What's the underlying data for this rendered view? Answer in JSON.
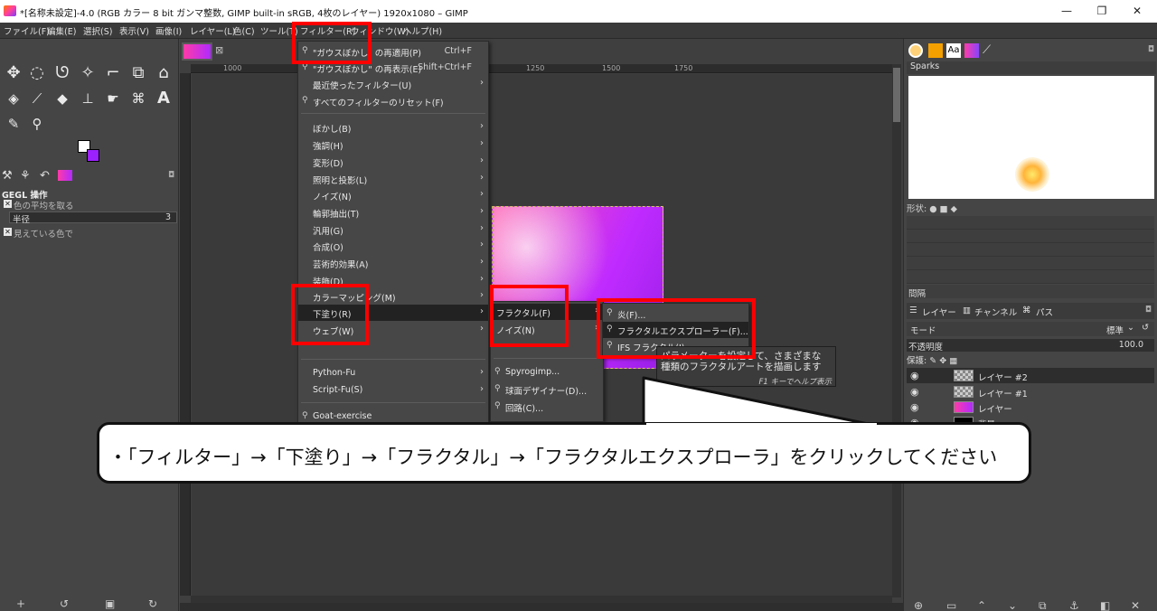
{
  "window": {
    "title": "*[名称未設定]-4.0 (RGB カラー 8 bit ガンマ整数, GIMP built-in sRGB, 4枚のレイヤー) 1920x1080 – GIMP",
    "minimize": "—",
    "maximize": "❐",
    "close": "✕"
  },
  "menubar": [
    "ファイル(F)",
    "編集(E)",
    "選択(S)",
    "表示(V)",
    "画像(I)",
    "レイヤー(L)",
    "色(C)",
    "ツール(T)",
    "フィルター(R)",
    "ウィンドウ(W)",
    "ヘルプ(H)"
  ],
  "tool_options": {
    "title": "GEGL 操作",
    "option1": "色の平均を取る",
    "radius_label": "半径",
    "radius_value": "3",
    "option2": "見えている色で"
  },
  "canvas": {
    "ruler_ticks": [
      "1000",
      "1250",
      "1500",
      "1750"
    ]
  },
  "filters_menu": {
    "items": [
      {
        "label": "\"ガウスぼかし\" の再適用(P)",
        "shortcut": "Ctrl+F"
      },
      {
        "label": "\"ガウスぼかし\" の再表示(E)",
        "shortcut": "Shift+Ctrl+F"
      },
      {
        "label": "最近使ったフィルター(U)"
      },
      {
        "label": "すべてのフィルターのリセット(F)"
      },
      {
        "label": "ぼかし(B)"
      },
      {
        "label": "強調(H)"
      },
      {
        "label": "変形(D)"
      },
      {
        "label": "照明と投影(L)"
      },
      {
        "label": "ノイズ(N)"
      },
      {
        "label": "輪郭抽出(T)"
      },
      {
        "label": "汎用(G)"
      },
      {
        "label": "合成(O)"
      },
      {
        "label": "芸術的効果(A)"
      },
      {
        "label": "装飾(D)"
      },
      {
        "label": "カラーマッピング(M)"
      },
      {
        "label": "下塗り(R)"
      },
      {
        "label": "ウェブ(W)"
      },
      {
        "label": "Python-Fu"
      },
      {
        "label": "Script-Fu(S)"
      },
      {
        "label": "Goat-exercise"
      }
    ]
  },
  "render_menu": {
    "items": [
      "フラクタル(F)",
      "ノイズ(N)",
      "Spyrogimp...",
      "球面デザイナー(D)...",
      "回路(C)..."
    ]
  },
  "fractal_menu": {
    "items": [
      "炎(F)...",
      "フラクタルエクスプローラー(F)...",
      "IFS フラクタル(I)..."
    ]
  },
  "tooltip": {
    "line1": "パラメーターを設定して、さまざまな",
    "line2": "種類のフラクタルアートを描画します",
    "hint": "F1 キーでヘルプ表示"
  },
  "callout": {
    "text": "・「フィルター」→「下塗り」→「フラクタル」→「フラクタルエクスプローラ」をクリックしてください"
  },
  "dock": {
    "brush_name": "Sparks",
    "shape_label": "形状:",
    "spacing_label": "間隔",
    "tabs": [
      "レイヤー",
      "チャンネル",
      "パス"
    ],
    "mode_label": "モード",
    "mode_value": "標準",
    "opacity_label": "不透明度",
    "opacity_value": "100.0",
    "lock_label": "保護:",
    "layers": [
      "レイヤー #2",
      "レイヤー #1",
      "レイヤー",
      "背景"
    ]
  },
  "colors": {
    "highlight_red": "#ff0000",
    "menu_bg": "#474747",
    "menu_highlight": "#222222"
  }
}
